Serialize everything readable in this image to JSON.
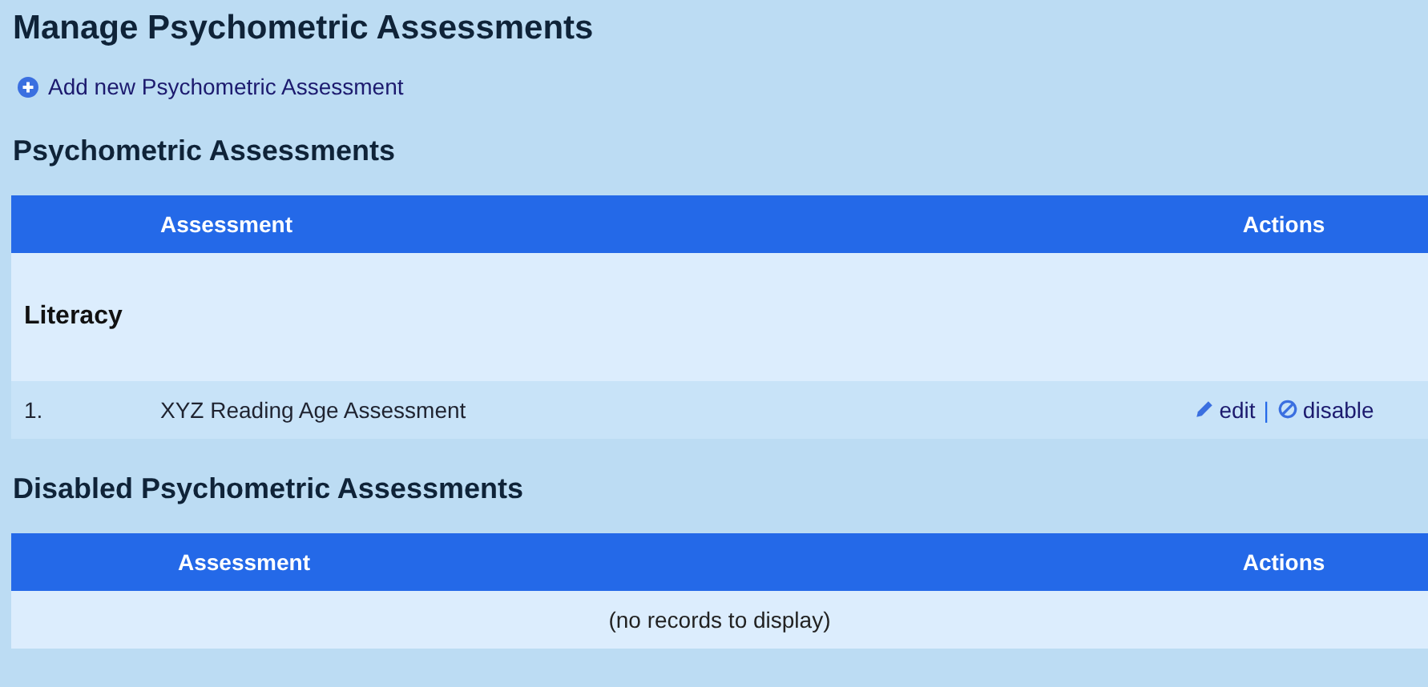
{
  "title": "Manage Psychometric Assessments",
  "add_link": {
    "label": "Add new Psychometric Assessment"
  },
  "active_section": {
    "heading": "Psychometric Assessments",
    "columns": [
      "Assessment",
      "Actions"
    ],
    "groups": [
      {
        "name": "Literacy",
        "rows": [
          {
            "number": "1.",
            "assessment": "XYZ Reading Age Assessment",
            "actions": [
              {
                "kind": "edit",
                "label": "edit"
              },
              {
                "kind": "disable",
                "label": "disable"
              }
            ],
            "separator": "|"
          }
        ]
      }
    ]
  },
  "disabled_section": {
    "heading": "Disabled Psychometric Assessments",
    "columns": [
      "Assessment",
      "Actions"
    ],
    "empty_message": "(no records to display)"
  }
}
